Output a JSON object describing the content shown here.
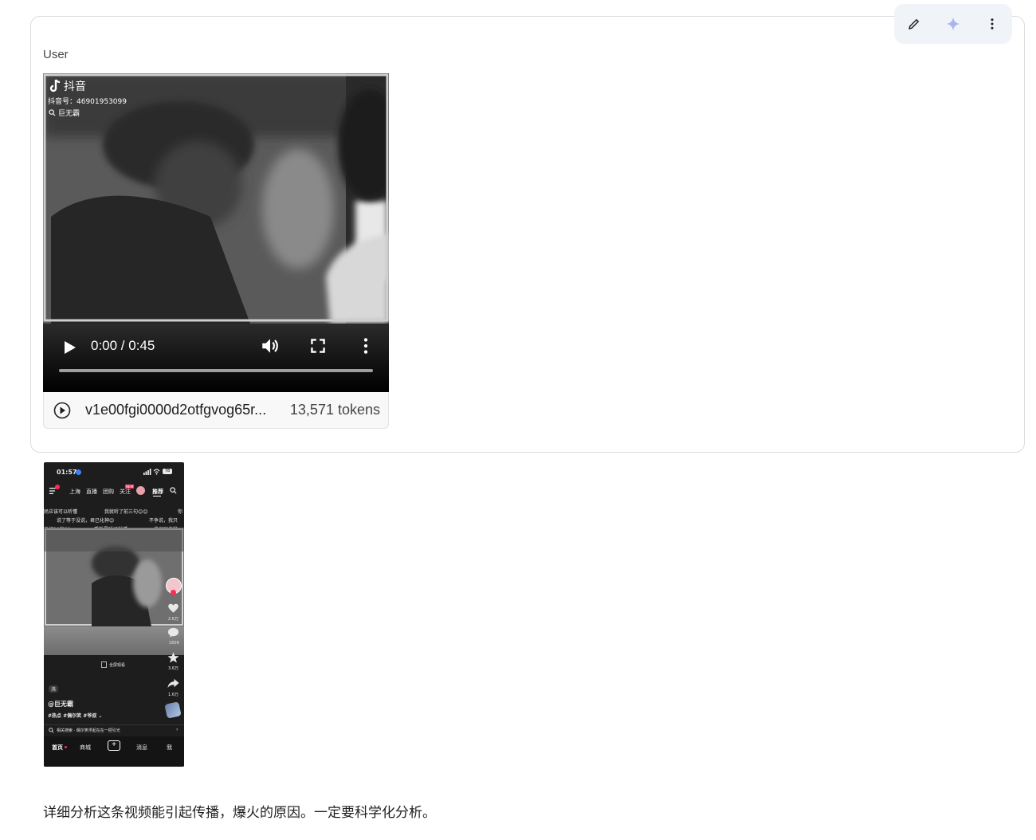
{
  "turn": {
    "role": "User",
    "actions": [
      "edit-icon",
      "sparkle-icon",
      "more-vert-icon"
    ]
  },
  "video": {
    "watermark_app": "抖音",
    "watermark_id": "抖音号：46901953099",
    "watermark_search": "巨无霸",
    "time": "0:00 / 0:45",
    "file_name": "v1e00fgi0000d2otfgvog65r...",
    "tokens": "13,571 tokens",
    "icons": [
      "play-icon",
      "volume-icon",
      "fullscreen-icon",
      "more-vert-icon",
      "play-circle-icon"
    ]
  },
  "screenshot": {
    "status_time": "01:57",
    "battery": "78",
    "tabs": [
      "上海",
      "直播",
      "团购",
      "关注",
      "推荐"
    ],
    "follow_badge": "NEW",
    "danmaku": [
      "民应该可以听懂",
      "我就听了前三句😊😊",
      "你",
      "说了等于没说，君已化神😊",
      "不争说，我只",
      "二打80家60",
      "重新是睡了就遁",
      "俺邻居老爷"
    ],
    "likes": "2.6万",
    "comments": "1609",
    "favorites": "3.6万",
    "shares": "1.6万",
    "fullscreen_label": "全屏观看",
    "author_badge": "沸",
    "author": "@巨无霸",
    "hashtags": "#热点 #偶尔笑 #爷叔 ⌄",
    "search_suggestion": "相关搜索 · 偶尔笑浮起在在一把引光",
    "bottom_nav": [
      "首页",
      "商城",
      "+",
      "消息",
      "我"
    ]
  },
  "prompt": {
    "text": "详细分析这条视频能引起传播，爆火的原因。一定要科学化分析。"
  }
}
